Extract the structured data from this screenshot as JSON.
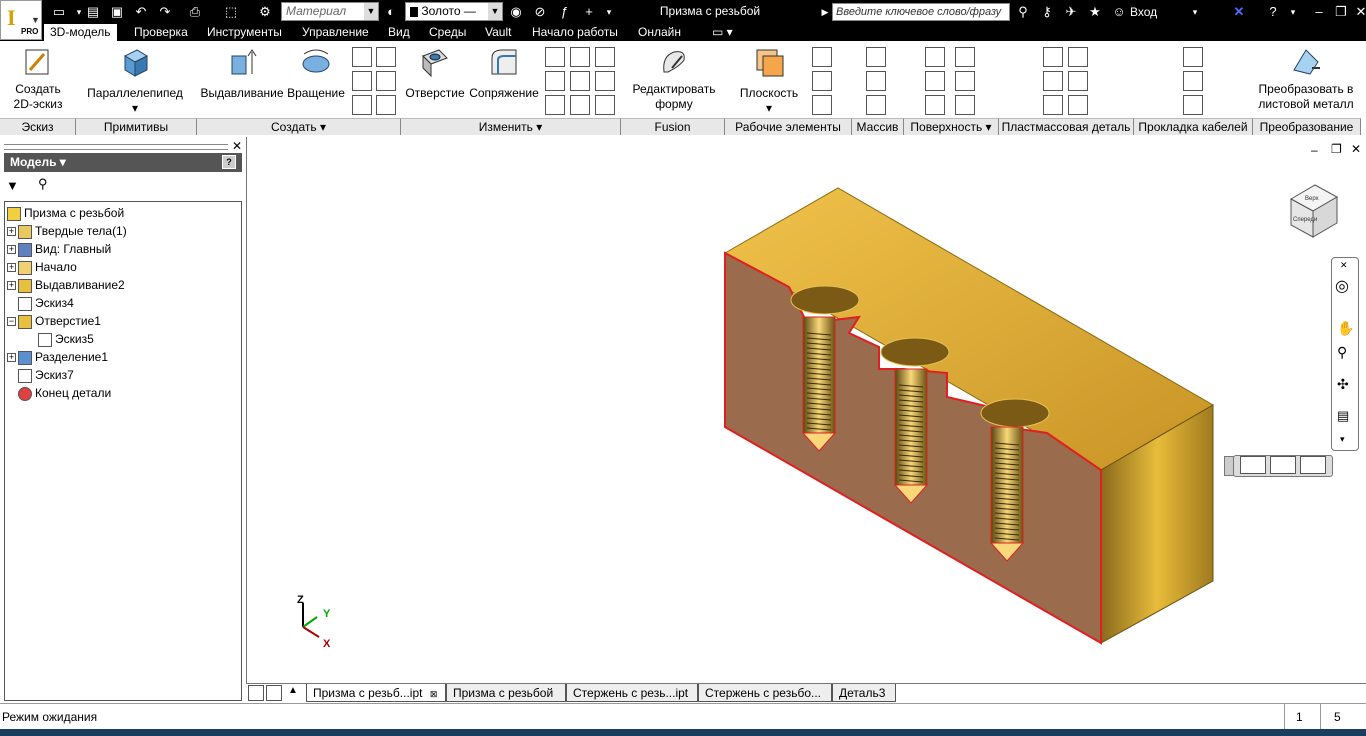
{
  "app": {
    "title": "Призма с резьбой",
    "logo_text": "I",
    "edition": "PRO"
  },
  "quick_access": {
    "material_placeholder": "Материал",
    "appearance_value": "Золото —",
    "search_placeholder": "Введите ключевое слово/фразу",
    "sign_in_label": "Вход"
  },
  "menu_tabs": [
    "3D-модель",
    "Проверка",
    "Инструменты",
    "Управление",
    "Вид",
    "Среды",
    "Vault",
    "Начало работы",
    "Онлайн"
  ],
  "ribbon": {
    "groups": [
      "Эскиз",
      "Примитивы",
      "Создать",
      "Изменить",
      "Fusion",
      "Рабочие элементы",
      "Массив",
      "Поверхность",
      "Пластмассовая деталь",
      "Прокладка кабелей",
      "Преобразование"
    ],
    "buttons": {
      "create_sketch": [
        "Создать",
        "2D-эскиз"
      ],
      "box": "Параллелепипед",
      "extrude": "Выдавливание",
      "revolve": "Вращение",
      "hole": "Отверстие",
      "fillet": "Сопряжение",
      "edit_form": [
        "Редактировать",
        "форму"
      ],
      "plane": "Плоскость",
      "convert": [
        "Преобразовать в",
        "листовой металл"
      ]
    }
  },
  "browser": {
    "header": "Модель",
    "items": [
      {
        "label": "Призма с резьбой",
        "level": 0,
        "expander": ""
      },
      {
        "label": "Твердые тела(1)",
        "level": 1,
        "expander": "+"
      },
      {
        "label": "Вид: Главный",
        "level": 1,
        "expander": "+"
      },
      {
        "label": "Начало",
        "level": 1,
        "expander": "+"
      },
      {
        "label": "Выдавливание2",
        "level": 1,
        "expander": "+"
      },
      {
        "label": "Эскиз4",
        "level": 1,
        "expander": ""
      },
      {
        "label": "Отверстие1",
        "level": 1,
        "expander": "−"
      },
      {
        "label": "Эскиз5",
        "level": 2,
        "expander": ""
      },
      {
        "label": "Разделение1",
        "level": 1,
        "expander": "+"
      },
      {
        "label": "Эскиз7",
        "level": 1,
        "expander": ""
      },
      {
        "label": "Конец детали",
        "level": 1,
        "expander": ""
      }
    ]
  },
  "viewcube": {
    "face_top": "Верх",
    "face_front": "Спереди"
  },
  "triad": {
    "x": "X",
    "y": "Y",
    "z": "Z"
  },
  "doc_tabs": [
    "Призма с резьб...ipt",
    "Призма с резьбой",
    "Стержень с резь...ipt",
    "Стержень с резьбо...",
    "Деталь3"
  ],
  "status": {
    "text": "Режим ожидания",
    "num1": "1",
    "num2": "5"
  },
  "colors": {
    "gold_top": "#d4a52c",
    "gold_side": "#b88a22",
    "section_face": "#9a6b4d",
    "section_edge": "#e02020"
  }
}
